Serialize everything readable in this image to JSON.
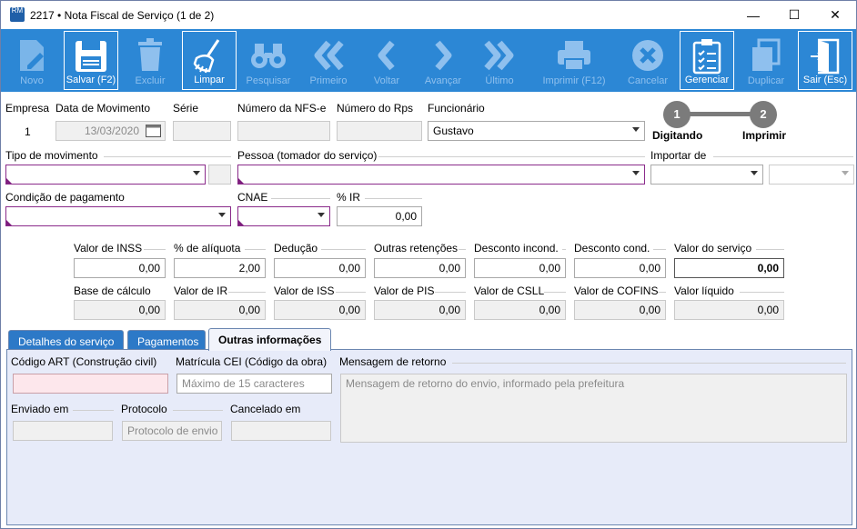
{
  "window": {
    "title": "2217 • Nota Fiscal de Serviço (1 de 2)",
    "icon_text": "RM",
    "minimize": "—",
    "maximize": "☐",
    "close": "✕"
  },
  "toolbar": [
    {
      "id": "novo",
      "label": "Novo",
      "icon": "document-edit-icon",
      "enabled": false
    },
    {
      "id": "salvar",
      "label": "Salvar (F2)",
      "icon": "save-disk-icon",
      "enabled": true
    },
    {
      "id": "excluir",
      "label": "Excluir",
      "icon": "trash-icon",
      "enabled": false
    },
    {
      "id": "limpar",
      "label": "Limpar",
      "icon": "broom-icon",
      "enabled": true
    },
    {
      "id": "pesquisar",
      "label": "Pesquisar",
      "icon": "binoculars-icon",
      "enabled": false
    },
    {
      "id": "primeiro",
      "label": "Primeiro",
      "icon": "double-chevron-left-icon",
      "enabled": false
    },
    {
      "id": "voltar",
      "label": "Voltar",
      "icon": "chevron-left-icon",
      "enabled": false
    },
    {
      "id": "avancar",
      "label": "Avançar",
      "icon": "chevron-right-icon",
      "enabled": false
    },
    {
      "id": "ultimo",
      "label": "Último",
      "icon": "double-chevron-right-icon",
      "enabled": false
    },
    {
      "id": "imprimir",
      "label": "Imprimir (F12)",
      "icon": "printer-icon",
      "enabled": false
    },
    {
      "id": "cancelar",
      "label": "Cancelar",
      "icon": "cancel-circle-icon",
      "enabled": false
    },
    {
      "id": "gerenciar",
      "label": "Gerenciar",
      "icon": "clipboard-checklist-icon",
      "enabled": true
    },
    {
      "id": "duplicar",
      "label": "Duplicar",
      "icon": "duplicate-icon",
      "enabled": false
    },
    {
      "id": "sair",
      "label": "Sair (Esc)",
      "icon": "exit-door-icon",
      "enabled": true
    }
  ],
  "header": {
    "empresa_label": "Empresa",
    "empresa_value": "1",
    "data_label": "Data de Movimento",
    "data_value": "13/03/2020",
    "serie_label": "Série",
    "serie_value": "",
    "nfse_label": "Número da NFS-e",
    "nfse_value": "",
    "rps_label": "Número do Rps",
    "rps_value": "",
    "funcionario_label": "Funcionário",
    "funcionario_value": "Gustavo"
  },
  "steps": [
    {
      "n": "1",
      "label": "Digitando"
    },
    {
      "n": "2",
      "label": "Imprimir"
    }
  ],
  "row2": {
    "tipo_label": "Tipo de movimento",
    "tipo_value": "",
    "pessoa_label": "Pessoa (tomador do serviço)",
    "pessoa_value": "",
    "importar_label": "Importar de",
    "importar_value": ""
  },
  "row3": {
    "condicao_label": "Condição de pagamento",
    "condicao_value": "",
    "cnae_label": "CNAE",
    "cnae_value": "",
    "ir_label": "% IR",
    "ir_value": "0,00"
  },
  "values_row1": [
    {
      "label": "Valor de INSS",
      "value": "0,00"
    },
    {
      "label": "% de alíquota",
      "value": "2,00"
    },
    {
      "label": "Dedução",
      "value": "0,00"
    },
    {
      "label": "Outras retenções",
      "value": "0,00"
    },
    {
      "label": "Desconto incond.",
      "value": "0,00"
    },
    {
      "label": "Desconto cond.",
      "value": "0,00"
    },
    {
      "label": "Valor do serviço",
      "value": "0,00"
    }
  ],
  "values_row2": [
    {
      "label": "Base de cálculo",
      "value": "0,00"
    },
    {
      "label": "Valor de IR",
      "value": "0,00"
    },
    {
      "label": "Valor de ISS",
      "value": "0,00"
    },
    {
      "label": "Valor de PIS",
      "value": "0,00"
    },
    {
      "label": "Valor de CSLL",
      "value": "0,00"
    },
    {
      "label": "Valor de COFINS",
      "value": "0,00"
    },
    {
      "label": "Valor líquido",
      "value": "0,00"
    }
  ],
  "tabs": [
    {
      "label": "Detalhes do serviço"
    },
    {
      "label": "Pagamentos"
    },
    {
      "label": "Outras informações",
      "active": true
    }
  ],
  "outras": {
    "art_label": "Código ART (Construção civil)",
    "art_value": "",
    "cei_label": "Matrícula CEI (Código da obra)",
    "cei_placeholder": "Máximo de 15 caracteres",
    "mensagem_label": "Mensagem de retorno",
    "mensagem_placeholder": "Mensagem de retorno do envio, informado pela prefeitura",
    "enviado_label": "Enviado em",
    "enviado_value": "",
    "protocolo_label": "Protocolo",
    "protocolo_placeholder": "Protocolo de envio",
    "cancelado_label": "Cancelado em",
    "cancelado_value": ""
  }
}
